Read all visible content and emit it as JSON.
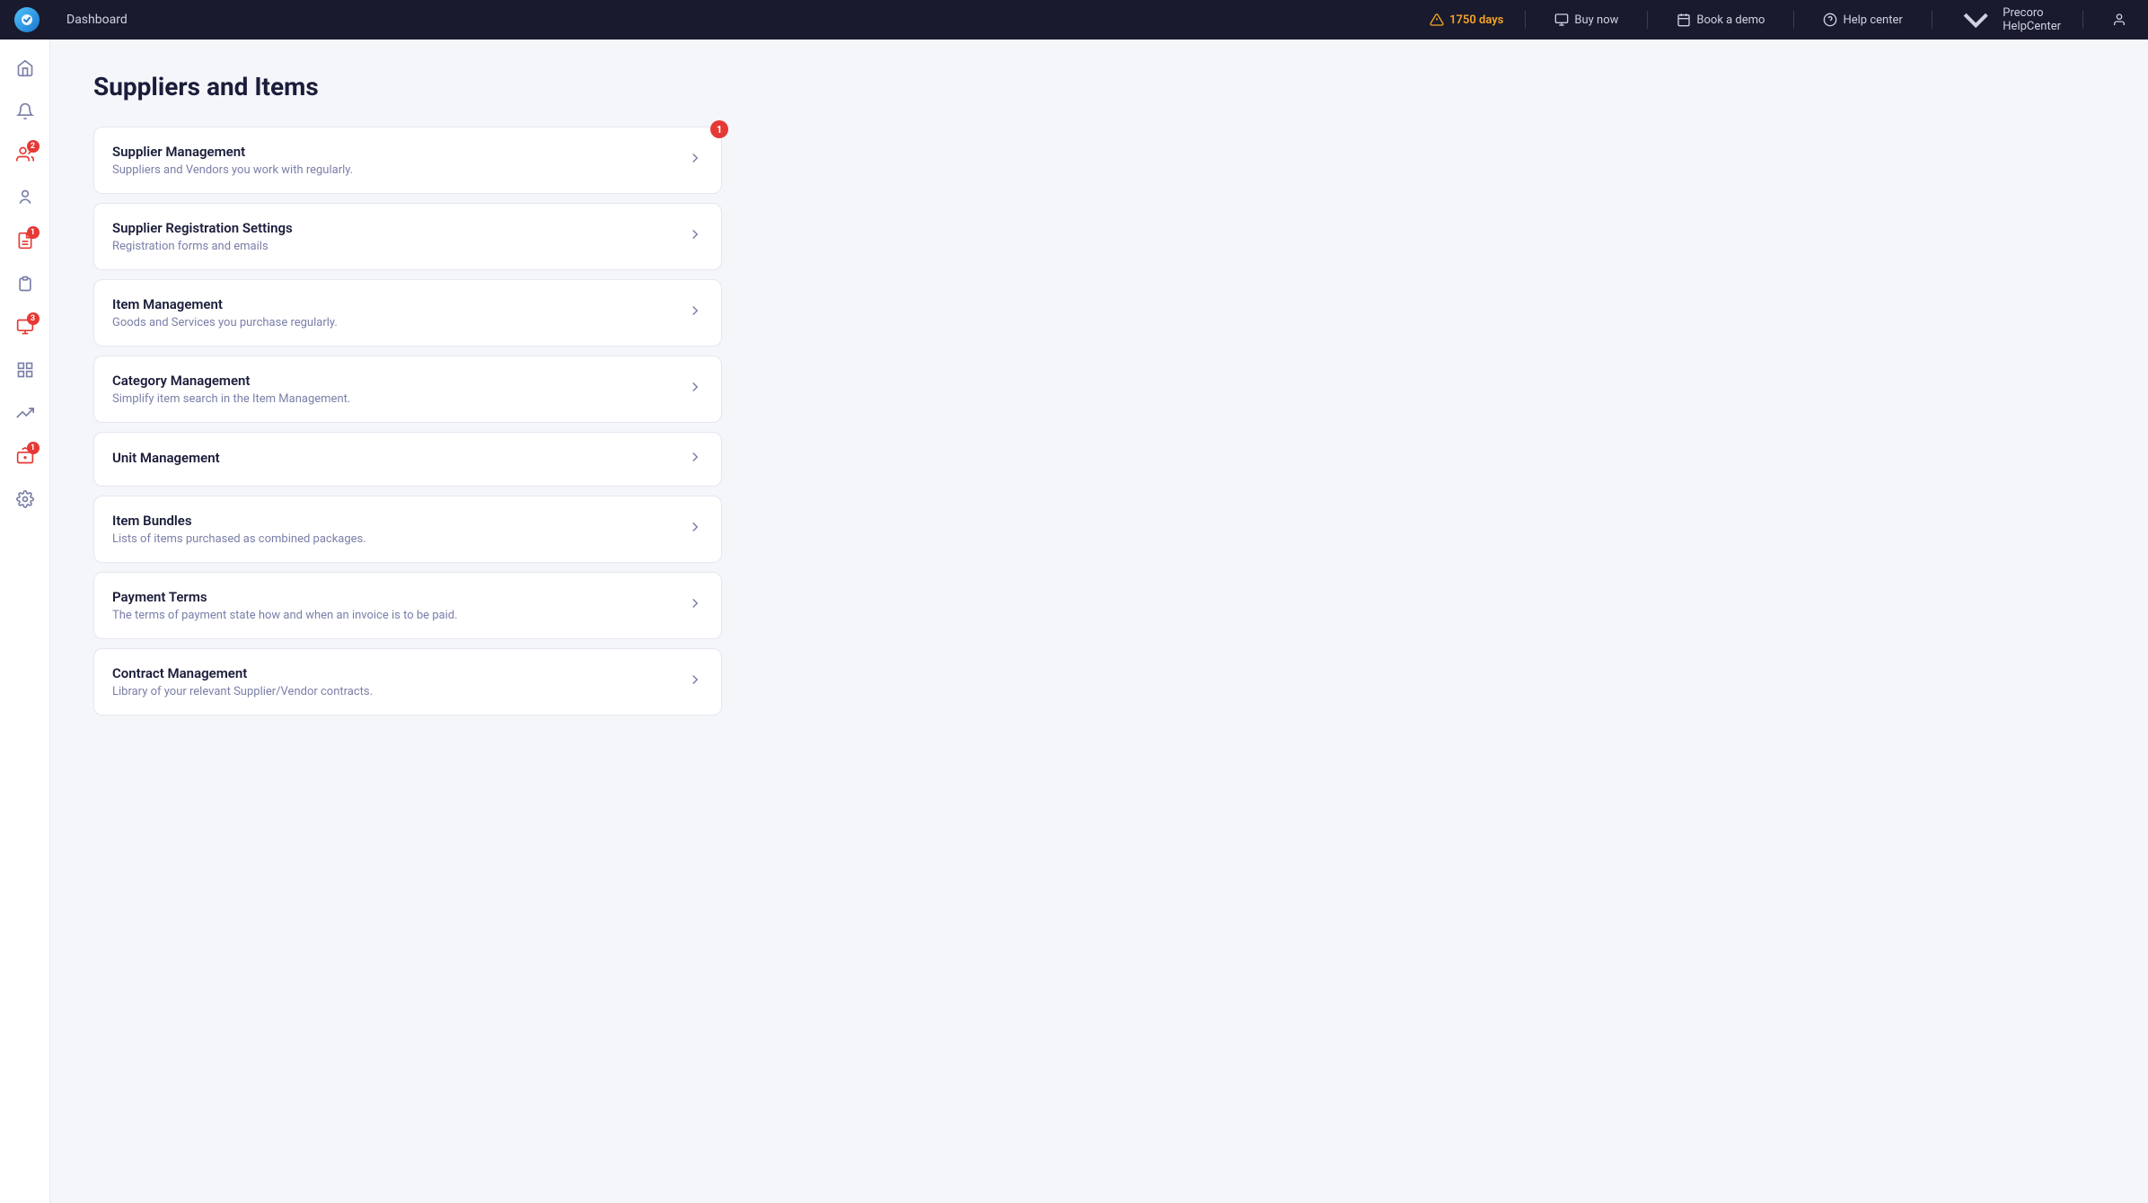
{
  "topnav": {
    "logo_alt": "Precoro logo",
    "dashboard_label": "Dashboard",
    "warning_days": "1750 days",
    "buy_now": "Buy now",
    "book_demo": "Book a demo",
    "help_center": "Help center",
    "org_name": "Precoro HelpCenter",
    "user_icon_alt": "user"
  },
  "sidebar": {
    "items": [
      {
        "name": "home",
        "icon": "home",
        "badge": null
      },
      {
        "name": "notifications",
        "icon": "bell",
        "badge": null
      },
      {
        "name": "users",
        "icon": "users",
        "badge": "2"
      },
      {
        "name": "suppliers",
        "icon": "people",
        "badge": null
      },
      {
        "name": "orders",
        "icon": "clipboard",
        "badge": "1"
      },
      {
        "name": "receipts",
        "icon": "receipt",
        "badge": null
      },
      {
        "name": "invoices",
        "icon": "invoice",
        "badge": "3"
      },
      {
        "name": "reports",
        "icon": "chart-bar",
        "badge": null
      },
      {
        "name": "analytics",
        "icon": "trend",
        "badge": null
      },
      {
        "name": "integrations",
        "icon": "integration",
        "badge": "1"
      },
      {
        "name": "settings",
        "icon": "settings",
        "badge": null
      }
    ]
  },
  "page": {
    "title": "Suppliers and Items"
  },
  "cards": [
    {
      "id": "supplier-management",
      "title": "Supplier Management",
      "description": "Suppliers and Vendors you work with regularly.",
      "badge": "1"
    },
    {
      "id": "supplier-registration",
      "title": "Supplier Registration Settings",
      "description": "Registration forms and emails",
      "badge": null
    },
    {
      "id": "item-management",
      "title": "Item Management",
      "description": "Goods and Services you purchase regularly.",
      "badge": null
    },
    {
      "id": "category-management",
      "title": "Category Management",
      "description": "Simplify item search in the Item Management.",
      "badge": null
    },
    {
      "id": "unit-management",
      "title": "Unit Management",
      "description": "",
      "badge": null
    },
    {
      "id": "item-bundles",
      "title": "Item Bundles",
      "description": "Lists of items purchased as combined packages.",
      "badge": null
    },
    {
      "id": "payment-terms",
      "title": "Payment Terms",
      "description": "The terms of payment state how and when an invoice is to be paid.",
      "badge": null
    },
    {
      "id": "contract-management",
      "title": "Contract Management",
      "description": "Library of your relevant Supplier/Vendor contracts.",
      "badge": null
    }
  ]
}
